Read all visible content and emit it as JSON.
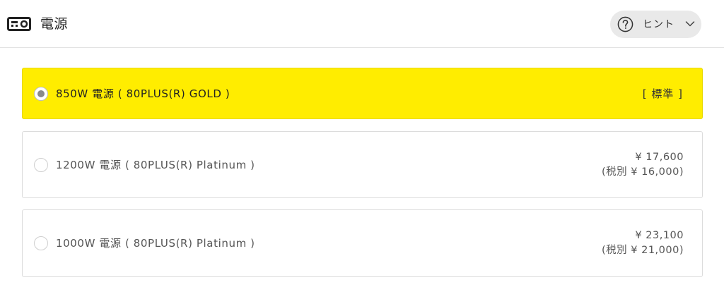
{
  "header": {
    "icon": "power-supply-icon",
    "title": "電源",
    "hint_icon": "question-circle-icon",
    "hint_label": "ヒント",
    "hint_chevron": "chevron-down-icon"
  },
  "options": [
    {
      "label": "850W 電源 ( 80PLUS(R) GOLD )",
      "selected": true,
      "tag": "[ 標準 ]",
      "price": "",
      "price_ex_tax": ""
    },
    {
      "label": "1200W 電源 ( 80PLUS(R) Platinum )",
      "selected": false,
      "tag": "",
      "price": "¥ 17,600",
      "price_ex_tax": "(税別 ¥ 16,000)"
    },
    {
      "label": "1000W 電源 ( 80PLUS(R) Platinum )",
      "selected": false,
      "tag": "",
      "price": "¥ 23,100",
      "price_ex_tax": "(税別 ¥ 21,000)"
    }
  ],
  "colors": {
    "selected_background": "#ffed00",
    "hint_background": "#e9e9e9",
    "border": "#dcdcdc"
  }
}
